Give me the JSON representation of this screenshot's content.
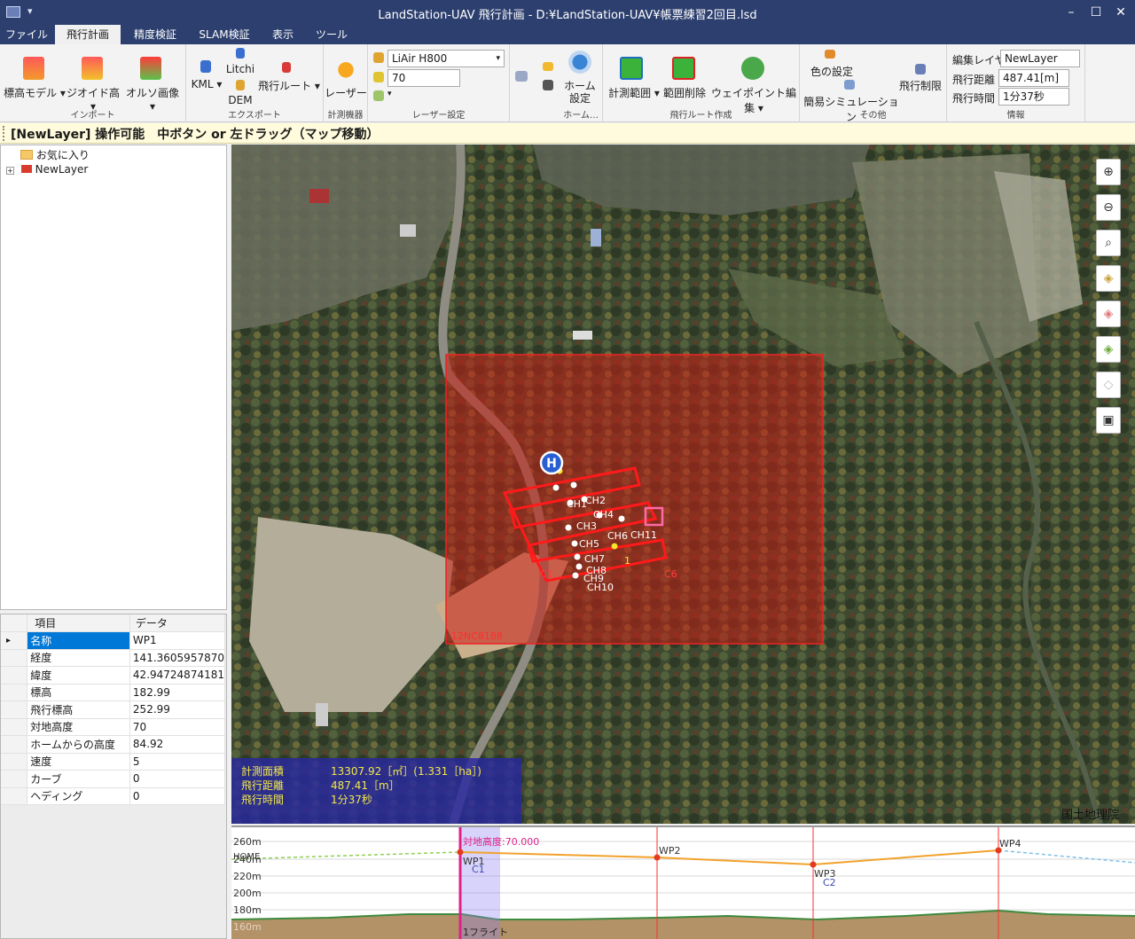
{
  "window": {
    "title": "LandStation-UAV 飛行計画 - D:¥LandStation-UAV¥帳票練習2回目.lsd",
    "quick_access": "▾",
    "minimize": "–",
    "maximize": "☐",
    "close": "✕"
  },
  "menu_tabs": [
    "ファイル",
    "飛行計画",
    "精度検証",
    "SLAM検証",
    "表示",
    "ツール"
  ],
  "active_tab": "飛行計画",
  "ribbon": {
    "import": {
      "label": "インポート",
      "elevation_model": "標高モデル",
      "geoid_height": "ジオイド高",
      "ortho_image": "オルソ画像"
    },
    "export": {
      "label": "エクスポート",
      "kml": "KML",
      "litchi": "Litchi",
      "dem": "DEM",
      "flight_route": "飛行ルート"
    },
    "equipment": {
      "label": "計測機器",
      "laser": "レーザー"
    },
    "laser_settings": {
      "label": "レーザー設定",
      "model": "LiAir H800",
      "value": "70"
    },
    "home": {
      "label": "ホーム…",
      "home_settings": "ホーム\n設定"
    },
    "route": {
      "label": "飛行ルート作成",
      "measure_range": "計測範囲",
      "delete_range": "範囲削除",
      "waypoint_edit": "ウェイポイント編集"
    },
    "other": {
      "label": "その他",
      "color_settings": "色の設定",
      "simple_simulation": "簡易シミュレーション",
      "flight_limit": "飛行制限"
    },
    "info": {
      "label": "情報",
      "layer_label": "編集レイヤ",
      "layer_value": "NewLayer",
      "distance_label": "飛行距離",
      "distance_value": "487.41[m]",
      "time_label": "飛行時間",
      "time_value": "1分37秒"
    }
  },
  "status_line": "[NewLayer] 操作可能　中ボタン or 左ドラッグ（マップ移動）",
  "tree": {
    "favorites": "お気に入り",
    "layer": "NewLayer"
  },
  "properties": {
    "header_item": "項目",
    "header_data": "データ",
    "rows": [
      {
        "key": "名称",
        "value": "WP1"
      },
      {
        "key": "経度",
        "value": "141.3605957870"
      },
      {
        "key": "緯度",
        "value": "42.94724874181"
      },
      {
        "key": "標高",
        "value": "182.99"
      },
      {
        "key": "飛行標高",
        "value": "252.99"
      },
      {
        "key": "対地高度",
        "value": "70"
      },
      {
        "key": "ホームからの高度",
        "value": "84.92"
      },
      {
        "key": "速度",
        "value": "5"
      },
      {
        "key": "カーブ",
        "value": "0"
      },
      {
        "key": "ヘディング",
        "value": "0"
      }
    ]
  },
  "map": {
    "area_id": "12NC8188",
    "home_marker": "H",
    "lap_marker": "1",
    "checkpoints": [
      "CH1",
      "CH2",
      "CH3",
      "CH4",
      "CH5",
      "CH6",
      "CH7",
      "CH8",
      "CH9",
      "CH10",
      "CH11"
    ],
    "corner_labels": [
      "C1",
      "C6"
    ],
    "attribution": "国土地理院",
    "info": {
      "area_label": "計測面積",
      "area_value": "13307.92［㎡］(1.331［ha］)",
      "distance_label": "飛行距離",
      "distance_value": "487.41［m］",
      "time_label": "飛行時間",
      "time_value": "1分37秒"
    },
    "tools": [
      "zoom-in",
      "zoom-out",
      "zoom-fit",
      "layer-a",
      "layer-b",
      "layer-c",
      "eraser",
      "camera"
    ]
  },
  "profile": {
    "y_ticks": [
      "260m",
      "240m",
      "220m",
      "200m",
      "180m",
      "160m"
    ],
    "home_label": "HOME",
    "agl_label": "対地高度:70.000",
    "waypoints": [
      "WP1",
      "WP2",
      "WP3",
      "WP4"
    ],
    "sublabels": [
      "C1",
      "C2"
    ],
    "flight_label": "1フライト"
  }
}
